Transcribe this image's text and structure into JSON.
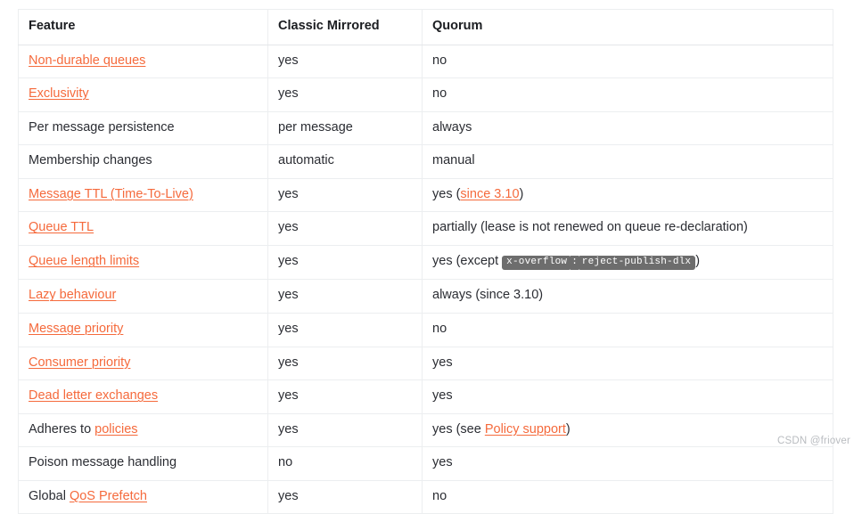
{
  "table": {
    "columns": [
      "Feature",
      "Classic Mirrored",
      "Quorum"
    ],
    "rows": [
      {
        "feature": {
          "text": "Non-durable queues",
          "link": true
        },
        "classic": "yes",
        "quorum": "no"
      },
      {
        "feature": {
          "text": "Exclusivity",
          "link": true
        },
        "classic": "yes",
        "quorum": "no"
      },
      {
        "feature": {
          "text": "Per message persistence",
          "link": false
        },
        "classic": "per message",
        "quorum": "always"
      },
      {
        "feature": {
          "text": "Membership changes",
          "link": false
        },
        "classic": "automatic",
        "quorum": "manual"
      },
      {
        "feature": {
          "text": "Message TTL (Time-To-Live)",
          "link": true
        },
        "classic": "yes",
        "quorum_parts": {
          "before": "yes (",
          "link": "since 3.10",
          "after": ")"
        }
      },
      {
        "feature": {
          "text": "Queue TTL",
          "link": true
        },
        "classic": "yes",
        "quorum": "partially (lease is not renewed on queue re-declaration)"
      },
      {
        "feature": {
          "text": "Queue length limits",
          "link": true
        },
        "classic": "yes",
        "quorum_code": {
          "before": "yes (except ",
          "code1": "x-overflow",
          "separator": ":",
          "code2": "reject-publish-dlx",
          "after": ")"
        }
      },
      {
        "feature": {
          "text": "Lazy behaviour",
          "link": true
        },
        "classic": "yes",
        "quorum": "always (since 3.10)"
      },
      {
        "feature": {
          "text": "Message priority",
          "link": true
        },
        "classic": "yes",
        "quorum": "no"
      },
      {
        "feature": {
          "text": "Consumer priority",
          "link": true
        },
        "classic": "yes",
        "quorum": "yes"
      },
      {
        "feature": {
          "text": "Dead letter exchanges",
          "link": true
        },
        "classic": "yes",
        "quorum": "yes"
      },
      {
        "feature_parts": {
          "before": "Adheres to ",
          "link": "policies",
          "after": ""
        },
        "classic": "yes",
        "quorum_parts": {
          "before": "yes (see ",
          "link": "Policy support",
          "after": ")"
        }
      },
      {
        "feature": {
          "text": "Poison message handling",
          "link": false
        },
        "classic": "no",
        "quorum": "yes"
      },
      {
        "feature_parts": {
          "before": "Global ",
          "link": "QoS Prefetch",
          "after": ""
        },
        "classic": "yes",
        "quorum": "no"
      }
    ]
  },
  "watermark": "CSDN @friover",
  "colors": {
    "link": "#f56a3c",
    "text": "#2b2d33",
    "border": "#eceef0",
    "code_badge_bg": "#6d6d6d",
    "watermark": "#b9bcc0"
  }
}
